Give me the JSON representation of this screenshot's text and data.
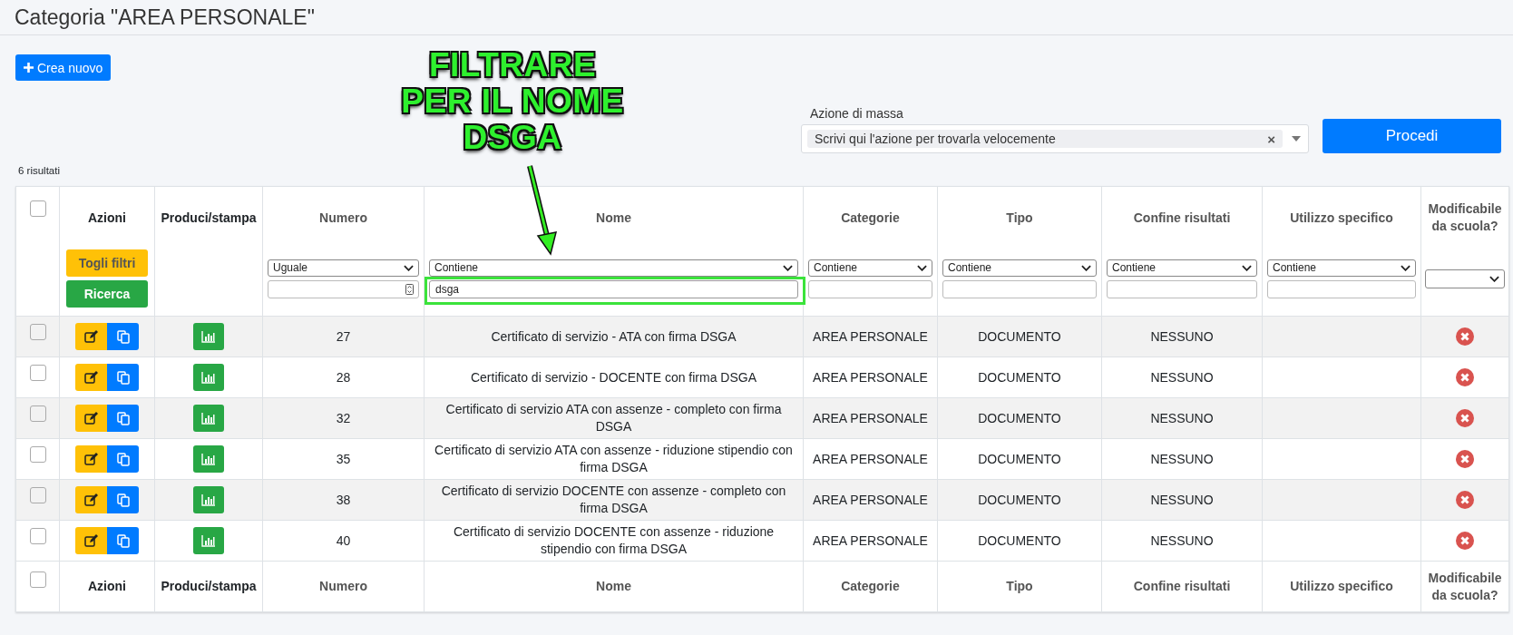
{
  "page_title": "Categoria \"AREA PERSONALE\"",
  "create_button": {
    "label": "Crea nuovo"
  },
  "annotation": {
    "text": "FILTRARE\nPER IL NOME\nDSGA"
  },
  "mass_action": {
    "label": "Azione di massa",
    "value": "Scrivi qui l'azione per trovarla velocemente",
    "clear": "×"
  },
  "proceed_button": {
    "label": "Procedi"
  },
  "result_count": "6 risultati",
  "table": {
    "select_all": {
      "checked": false
    },
    "columns": [
      {
        "label": "Azioni",
        "kind": "actions",
        "sortable": false,
        "filter": {
          "buttons": [
            {
              "label": "Togli filtri",
              "kind": "reset"
            },
            {
              "label": "Ricerca",
              "kind": "search"
            }
          ]
        }
      },
      {
        "label": "Produci/stampa",
        "kind": "print",
        "sortable": false
      },
      {
        "label": "Numero",
        "kind": "number",
        "sortable": true,
        "filter": {
          "operator": "Uguale"
        }
      },
      {
        "label": "Nome",
        "kind": "text",
        "sortable": true,
        "filter": {
          "operator": "Contiene",
          "value": "dsga",
          "highlighted": true
        }
      },
      {
        "label": "Categorie",
        "kind": "text",
        "sortable": true,
        "filter": {
          "operator": "Contiene",
          "highlighted": false
        }
      },
      {
        "label": "Tipo",
        "kind": "text",
        "sortable": true,
        "filter": {
          "operator": "Contiene",
          "highlighted": false
        }
      },
      {
        "label": "Confine risultati",
        "kind": "text",
        "sortable": true,
        "filter": {
          "operator": "Contiene",
          "highlighted": false
        }
      },
      {
        "label": "Utilizzo specifico",
        "kind": "text",
        "sortable": true,
        "filter": {
          "operator": "Contiene",
          "highlighted": false
        }
      },
      {
        "label": "Modificabile da scuola?",
        "kind": "boolean",
        "sortable": true
      }
    ],
    "rows": [
      {
        "checked": false,
        "number": "27",
        "name": "Certificato di servizio - ATA con firma DSGA",
        "category": "AREA PERSONALE",
        "type": "DOCUMENTO",
        "result_scope": "NESSUNO",
        "editable": false
      },
      {
        "checked": false,
        "number": "28",
        "name": "Certificato di servizio - DOCENTE con firma DSGA",
        "category": "AREA PERSONALE",
        "type": "DOCUMENTO",
        "result_scope": "NESSUNO",
        "editable": false
      },
      {
        "checked": false,
        "number": "32",
        "name": "Certificato di servizio ATA con assenze - completo con firma DSGA",
        "category": "AREA PERSONALE",
        "type": "DOCUMENTO",
        "result_scope": "NESSUNO",
        "editable": false
      },
      {
        "checked": false,
        "number": "35",
        "name": "Certificato di servizio ATA con assenze - riduzione stipendio con firma DSGA",
        "category": "AREA PERSONALE",
        "type": "DOCUMENTO",
        "result_scope": "NESSUNO",
        "editable": false
      },
      {
        "checked": false,
        "number": "38",
        "name": "Certificato di servizio DOCENTE con assenze - completo con firma DSGA",
        "category": "AREA PERSONALE",
        "type": "DOCUMENTO",
        "result_scope": "NESSUNO",
        "editable": false
      },
      {
        "checked": false,
        "number": "40",
        "name": "Certificato di servizio DOCENTE con assenze - riduzione stipendio con firma DSGA",
        "category": "AREA PERSONALE",
        "type": "DOCUMENTO",
        "result_scope": "NESSUNO",
        "editable": false
      }
    ],
    "footer_select_all": {
      "checked": false
    },
    "footer": [
      "Azioni",
      "Produci/stampa",
      "Numero",
      "Nome",
      "Categorie",
      "Tipo",
      "Confine risultati",
      "Utilizzo specifico",
      "Modificabile da scuola?"
    ]
  }
}
